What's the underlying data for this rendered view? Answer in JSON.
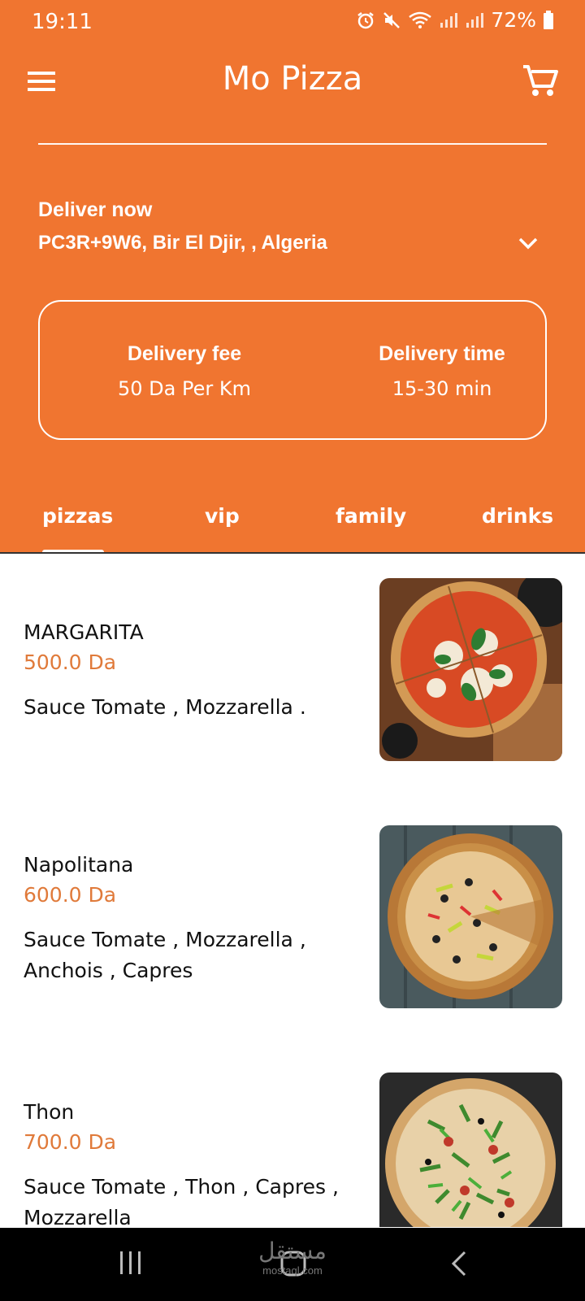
{
  "status_bar": {
    "time": "19:11",
    "battery": "72%"
  },
  "app_bar": {
    "title": "Mo Pizza",
    "menu_icon": "hamburger-menu-icon",
    "cart_icon": "shopping-cart-icon"
  },
  "delivery": {
    "label": "Deliver now",
    "address": "PC3R+9W6, Bir El Djir, , Algeria"
  },
  "info": {
    "fee_label": "Delivery fee",
    "fee_value": "50 Da Per Km",
    "time_label": "Delivery time",
    "time_value": "15-30 min"
  },
  "tabs": [
    {
      "label": "pizzas",
      "active": true
    },
    {
      "label": "vip",
      "active": false
    },
    {
      "label": "family",
      "active": false
    },
    {
      "label": "drinks",
      "active": false
    }
  ],
  "items": [
    {
      "name": "MARGARITA",
      "price": "500.0 Da",
      "description": "Sauce Tomate , Mozzarella ."
    },
    {
      "name": "Napolitana",
      "price": "600.0 Da",
      "description": "Sauce Tomate , Mozzarella , Anchois , Capres"
    },
    {
      "name": "Thon",
      "price": "700.0 Da",
      "description": "Sauce Tomate , Thon , Capres , Mozzarella"
    }
  ],
  "watermark": {
    "text": "مستقل",
    "sub": "mostaql.com"
  },
  "colors": {
    "brand": "#F07530",
    "price": "#E07A3A"
  }
}
